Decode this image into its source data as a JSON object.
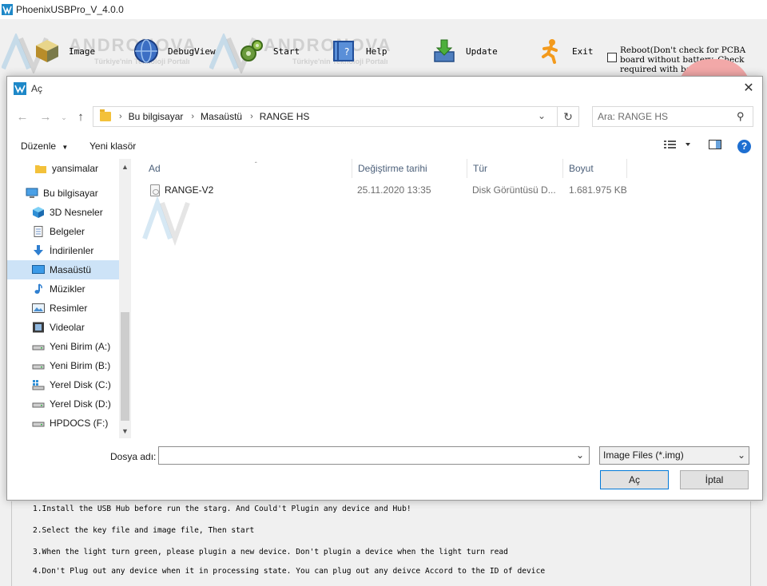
{
  "app": {
    "title": "PhoenixUSBPro_V_4.0.0",
    "toolbar": {
      "image_label": "Image",
      "debugview_label": "DebugView",
      "start_label": "Start",
      "help_label": "Help",
      "update_label": "Update",
      "exit_label": "Exit"
    },
    "reboot_text": "Reboot(Don't check for PCBA board without battery. Check required with battery)",
    "watermark": {
      "brand": "ANDRONOVA",
      "tagline": "Türkiye'nin Teknoloji Portalı"
    },
    "instructions": [
      "1.Install the USB Hub before run the starg. And Could't Plugin any device and Hub!",
      "2.Select the key file and image file, Then start",
      "3.When the light turn green, please plugin a new device. Don't plugin a device when the light turn read",
      "4.Don't Plug out any device when it in processing state. You can plug out any deivce Accord to the ID of device"
    ]
  },
  "dialog": {
    "title": "Aç",
    "breadcrumb": [
      "Bu bilgisayar",
      "Masaüstü",
      "RANGE HS"
    ],
    "search_placeholder": "Ara: RANGE HS",
    "commands": {
      "organize": "Düzenle",
      "new_folder": "Yeni klasör"
    },
    "nav_items": [
      {
        "label": "yansimalar",
        "icon": "folder-icon"
      },
      {
        "label": "Bu bilgisayar",
        "icon": "computer-icon"
      },
      {
        "label": "3D Nesneler",
        "icon": "3d-objects-icon"
      },
      {
        "label": "Belgeler",
        "icon": "documents-icon"
      },
      {
        "label": "İndirilenler",
        "icon": "downloads-icon"
      },
      {
        "label": "Masaüstü",
        "icon": "desktop-icon"
      },
      {
        "label": "Müzikler",
        "icon": "music-icon"
      },
      {
        "label": "Resimler",
        "icon": "pictures-icon"
      },
      {
        "label": "Videolar",
        "icon": "videos-icon"
      },
      {
        "label": "Yeni Birim (A:)",
        "icon": "drive-icon"
      },
      {
        "label": "Yeni Birim (B:)",
        "icon": "drive-icon"
      },
      {
        "label": "Yerel Disk (C:)",
        "icon": "windows-drive-icon"
      },
      {
        "label": "Yerel Disk (D:)",
        "icon": "drive-icon"
      },
      {
        "label": "HPDOCS (F:)",
        "icon": "drive-icon"
      }
    ],
    "selected_nav": "Masaüstü",
    "columns": [
      "Ad",
      "Değiştirme tarihi",
      "Tür",
      "Boyut"
    ],
    "files": [
      {
        "name": "RANGE-V2",
        "modified": "25.11.2020 13:35",
        "type": "Disk Görüntüsü D...",
        "size": "1.681.975 KB"
      }
    ],
    "filename_label": "Dosya adı:",
    "filename_value": "",
    "filter_value": "Image Files (*.img)",
    "open_label": "Aç",
    "cancel_label": "İptal"
  }
}
